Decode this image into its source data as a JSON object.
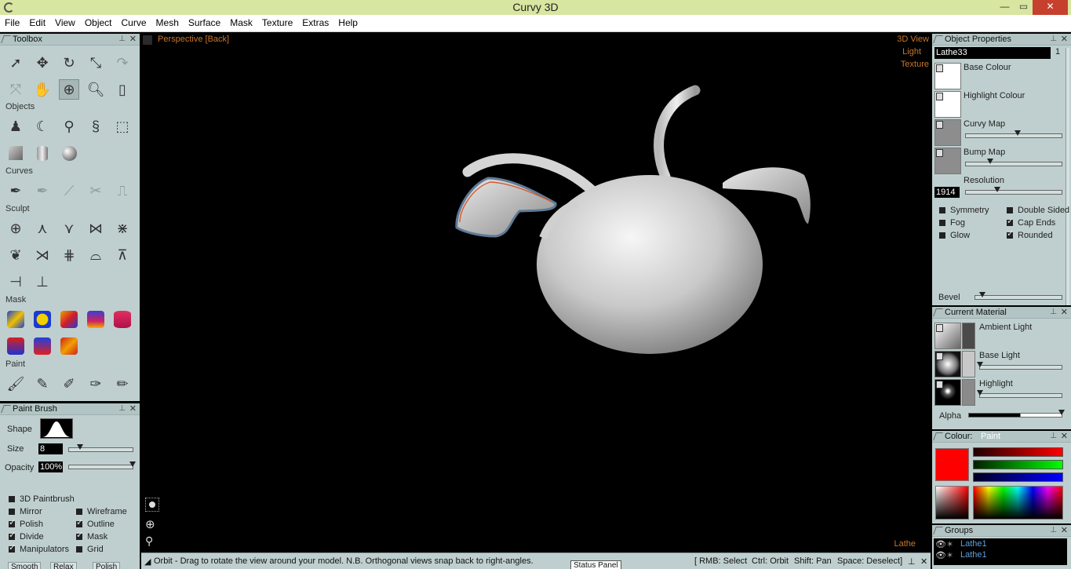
{
  "window": {
    "title": "Curvy 3D",
    "minimize": "—",
    "maximize": "▭",
    "close": "✕"
  },
  "menu": [
    "File",
    "Edit",
    "View",
    "Object",
    "Curve",
    "Mesh",
    "Surface",
    "Mask",
    "Texture",
    "Extras",
    "Help"
  ],
  "toolbox": {
    "title": "Toolbox",
    "sections": {
      "objects": "Objects",
      "curves": "Curves",
      "sculpt": "Sculpt",
      "mask": "Mask",
      "paint": "Paint"
    }
  },
  "paint_brush": {
    "title": "Paint Brush",
    "shape_label": "Shape",
    "size_label": "Size",
    "size_value": "8",
    "size_level": 0.17,
    "opacity_label": "Opacity",
    "opacity_value": "100%",
    "opacity_level": 1.0,
    "options": [
      {
        "label": "3D Paintbrush",
        "checked": false
      },
      {
        "label": "Mirror",
        "checked": false
      },
      {
        "label": "Wireframe",
        "checked": false
      },
      {
        "label": "Polish",
        "checked": true
      },
      {
        "label": "Outline",
        "checked": true
      },
      {
        "label": "Divide",
        "checked": true
      },
      {
        "label": "Mask",
        "checked": true
      },
      {
        "label": "Manipulators",
        "checked": true
      },
      {
        "label": "Grid",
        "checked": false
      }
    ],
    "bottom_tabs": [
      "Smooth",
      "Relax",
      "Polish"
    ]
  },
  "viewport": {
    "view_label": "Perspective [Back]",
    "mode_3d": "3D View",
    "mode_light": "Light",
    "mode_texture": "Texture",
    "object_type": "Lathe"
  },
  "status": {
    "hint": "Orbit - Drag to rotate the view around your model. N.B. Orthogonal views snap back to right-angles.",
    "rmb": "[ RMB: Select",
    "ctrl": "Ctrl: Orbit",
    "shift": "Shift: Pan",
    "space": "Space: Deselect]",
    "panel_tab": "Status Panel"
  },
  "object_properties": {
    "title": "Object Properties",
    "name": "Lathe33",
    "name_index": "1",
    "base_colour": "Base Colour",
    "highlight_colour": "Highlight Colour",
    "curvy_map": "Curvy Map",
    "curvy_map_level": 0.54,
    "bump_map": "Bump Map",
    "bump_map_level": 0.25,
    "resolution_label": "Resolution",
    "resolution_value": "1914",
    "resolution_level": 0.33,
    "options": [
      {
        "label": "Symmetry",
        "checked": false
      },
      {
        "label": "Double Sided",
        "checked": false
      },
      {
        "label": "Fog",
        "checked": false
      },
      {
        "label": "Cap Ends",
        "checked": true
      },
      {
        "label": "Glow",
        "checked": false
      },
      {
        "label": "Rounded",
        "checked": true
      }
    ],
    "bevel_label": "Bevel",
    "bevel_level": 0.08
  },
  "current_material": {
    "title": "Current Material",
    "ambient": "Ambient Light",
    "base": "Base Light",
    "base_level": 0.0,
    "highlight": "Highlight",
    "highlight_level": 0.0,
    "alpha": "Alpha",
    "alpha_level": 1.0
  },
  "colour": {
    "title": "Colour:",
    "mode": "Paint",
    "current": "#ff0000",
    "red_level": 1.0,
    "green_level": 0.0,
    "blue_level": 0.0
  },
  "groups": {
    "title": "Groups",
    "items": [
      "Lathe1",
      "Lathe1"
    ]
  }
}
